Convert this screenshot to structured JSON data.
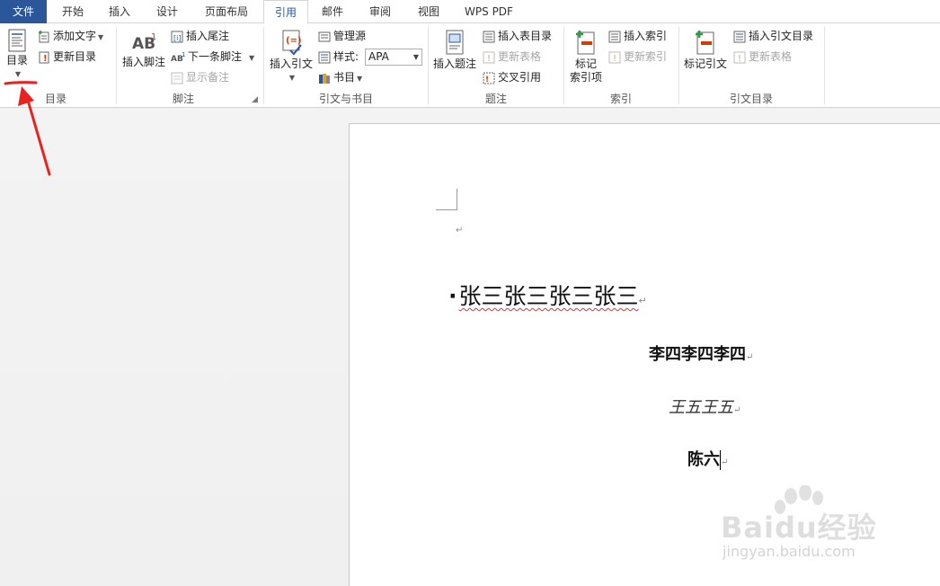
{
  "tabs": [
    {
      "label": "文件"
    },
    {
      "label": "开始"
    },
    {
      "label": "插入"
    },
    {
      "label": "设计"
    },
    {
      "label": "页面布局"
    },
    {
      "label": "引用"
    },
    {
      "label": "邮件"
    },
    {
      "label": "审阅"
    },
    {
      "label": "视图"
    },
    {
      "label": "WPS PDF"
    }
  ],
  "active_tab": "引用",
  "ribbon": {
    "toc": {
      "toc_button": "目录",
      "add_text": "添加文字",
      "update_toc": "更新目录",
      "group_label": "目录"
    },
    "footnotes": {
      "insert_footnote": "插入脚注",
      "insert_endnote": "插入尾注",
      "next_footnote": "下一条脚注",
      "show_notes": "显示备注",
      "group_label": "脚注"
    },
    "citations": {
      "insert_citation": "插入引文",
      "manage_sources": "管理源",
      "style_label": "样式:",
      "style_value": "APA",
      "bibliography": "书目",
      "group_label": "引文与书目"
    },
    "captions": {
      "insert_caption": "插入题注",
      "insert_table_of_figures": "插入表目录",
      "update_table": "更新表格",
      "cross_reference": "交叉引用",
      "group_label": "题注"
    },
    "index": {
      "mark_entry_line1": "标记",
      "mark_entry_line2": "索引项",
      "insert_index": "插入索引",
      "update_index": "更新索引",
      "group_label": "索引"
    },
    "table_of_authorities": {
      "mark_citation": "标记引文",
      "insert_toa": "插入引文目录",
      "update_table": "更新表格",
      "group_label": "引文目录"
    }
  },
  "document": {
    "line1": "张三张三张三张三",
    "line2": "李四李四李四",
    "line3": "王五王五",
    "line4": "陈六",
    "para_mark": "↵"
  },
  "watermark": {
    "logo": "Baidu经验",
    "url": "jingyan.baidu.com"
  },
  "colors": {
    "accent": "#2b579a",
    "annotation": "#e8231f"
  }
}
